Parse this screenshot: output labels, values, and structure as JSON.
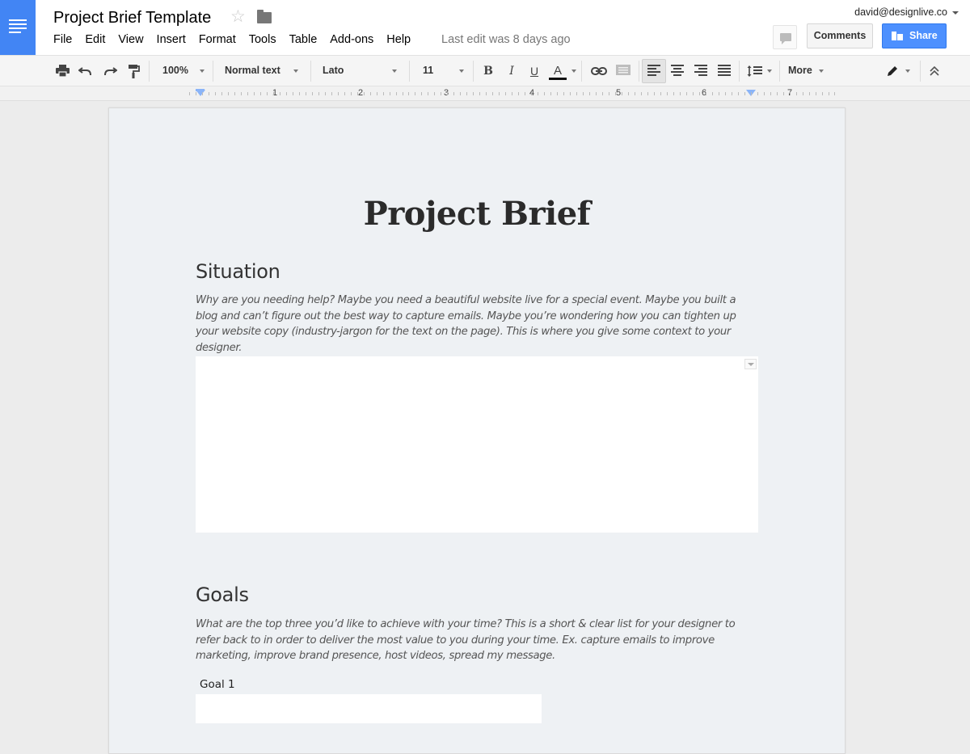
{
  "app": {
    "doc_title": "Project Brief Template",
    "last_edit": "Last edit was 8 days ago",
    "account": "david@designlive.co",
    "brand_color": "#4285f4"
  },
  "menu": [
    "File",
    "Edit",
    "View",
    "Insert",
    "Format",
    "Tools",
    "Table",
    "Add-ons",
    "Help"
  ],
  "header_buttons": {
    "comments": "Comments",
    "share": "Share"
  },
  "toolbar": {
    "zoom": "100%",
    "style": "Normal text",
    "font": "Lato",
    "size": "11",
    "bold": "B",
    "italic": "I",
    "underline": "U",
    "text_color": "A",
    "more": "More",
    "icons": [
      "print-icon",
      "undo-icon",
      "redo-icon",
      "paint-format-icon",
      "link-icon",
      "comment-icon",
      "align-left-icon",
      "align-center-icon",
      "align-right-icon",
      "justify-icon",
      "line-spacing-icon",
      "pencil-icon",
      "collapse-icon"
    ]
  },
  "ruler": {
    "numbers": [
      "1",
      "2",
      "3",
      "4",
      "5",
      "6",
      "7"
    ]
  },
  "document": {
    "title": "Project Brief",
    "sections": [
      {
        "heading": "Situation",
        "description": "Why are you needing help? Maybe you need a beautiful website live for a special event. Maybe you built a blog and can’t figure out the best way to capture emails. Maybe you’re wondering how you can tighten up your website copy (industry-jargon for the text on the page). This is where you give some context to your designer."
      },
      {
        "heading": "Goals",
        "description": "What are the top three you’d like to achieve with your time? This is a short & clear list for your designer to refer back to in order to deliver the most value to you during your time. Ex. capture emails to improve marketing, improve brand presence, host videos, spread my message.",
        "goal_label": "Goal 1"
      }
    ]
  }
}
